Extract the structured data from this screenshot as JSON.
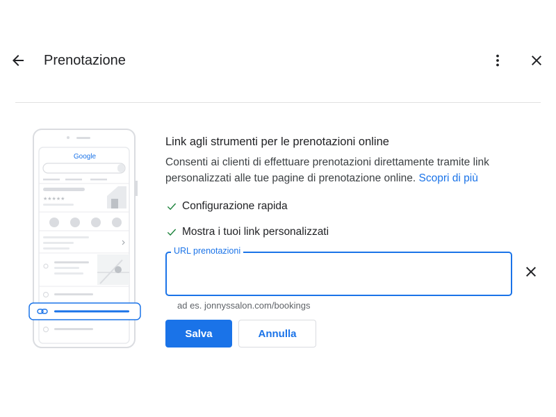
{
  "header": {
    "title": "Prenotazione",
    "back_icon": "arrow-back-icon",
    "more_icon": "more-vert-icon",
    "close_icon": "close-icon"
  },
  "illustration": {
    "brand_text": "Google",
    "rating_stars": "★★★★★"
  },
  "content": {
    "heading": "Link agli strumenti per le prenotazioni online",
    "description": "Consenti ai clienti di effettuare prenotazioni direttamente tramite link personalizzati alle tue pagine di prenotazione online.",
    "learn_more": "Scopri di più",
    "features": [
      {
        "label": "Configurazione rapida"
      },
      {
        "label": "Mostra i tuoi link personalizzati"
      }
    ]
  },
  "form": {
    "url_label": "URL prenotazioni",
    "url_value": "",
    "hint": "ad es. jonnyssalon.com/bookings",
    "clear_icon": "close-icon"
  },
  "actions": {
    "save_label": "Salva",
    "cancel_label": "Annulla"
  },
  "colors": {
    "accent": "#1a73e8",
    "check": "#188038",
    "text": "#202124",
    "muted": "#5f6368"
  }
}
